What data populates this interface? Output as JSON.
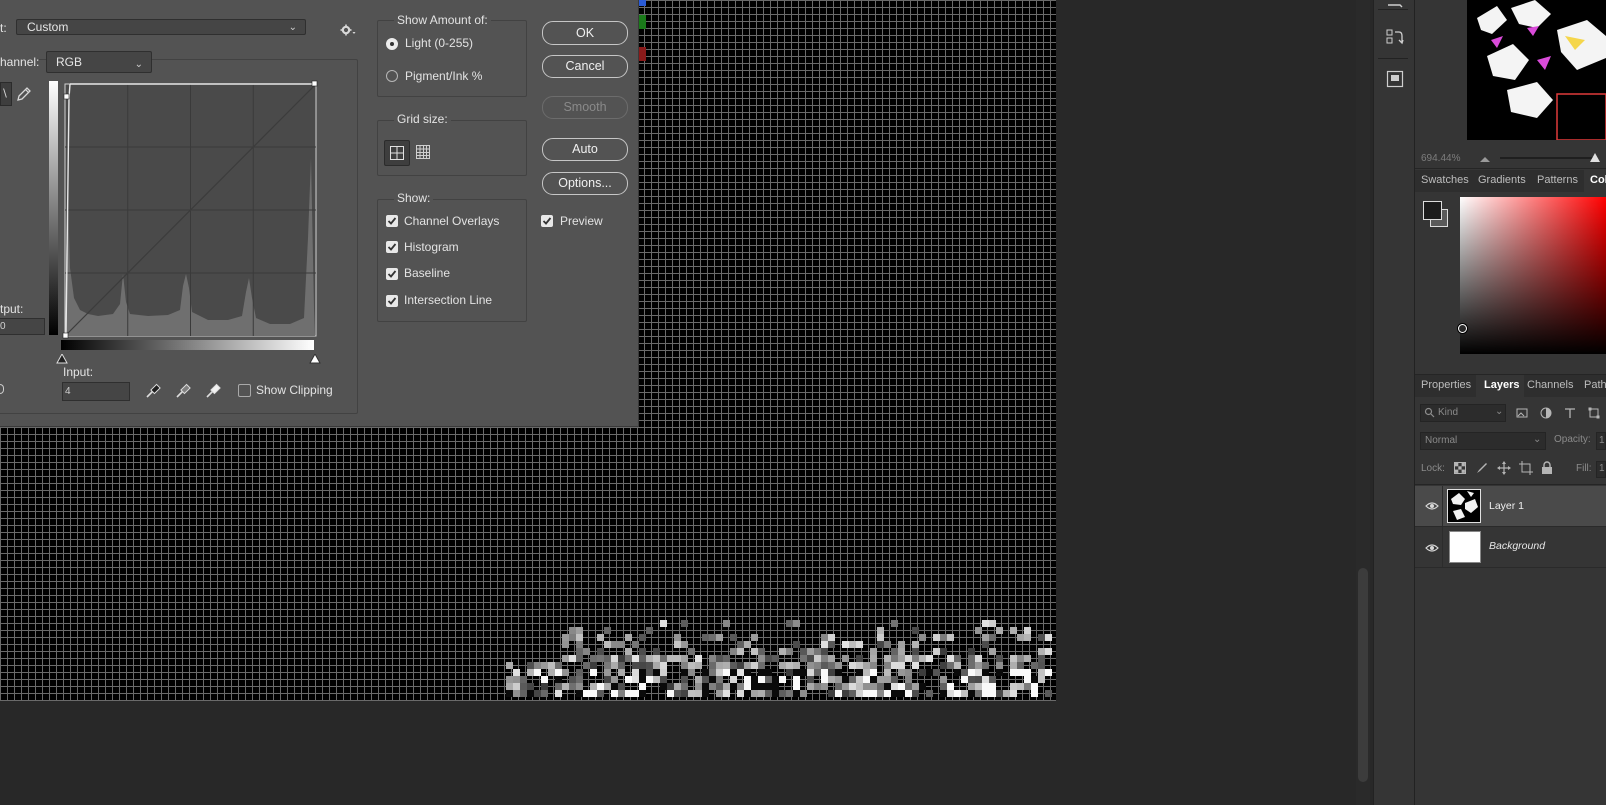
{
  "dialog": {
    "preset_label_partial": "t:",
    "preset_value": "Custom",
    "channel_label_partial": "hannel:",
    "channel_value": "RGB",
    "output_label_partial": "tput:",
    "output_value_partial": "0",
    "input_label": "Input:",
    "input_value": "4",
    "show_clipping_label": "Show Clipping",
    "show_amount": {
      "title": "Show Amount of:",
      "options": [
        {
          "label": "Light  (0-255)",
          "selected": true
        },
        {
          "label": "Pigment/Ink %",
          "selected": false
        }
      ]
    },
    "grid_size": {
      "title": "Grid size:"
    },
    "show": {
      "title": "Show:",
      "options": [
        {
          "label": "Channel Overlays",
          "checked": true
        },
        {
          "label": "Histogram",
          "checked": true
        },
        {
          "label": "Baseline",
          "checked": true
        },
        {
          "label": "Intersection Line",
          "checked": true
        }
      ]
    },
    "buttons": {
      "ok": "OK",
      "cancel": "Cancel",
      "smooth": "Smooth",
      "auto": "Auto",
      "options": "Options..."
    },
    "preview_label": "Preview",
    "preview_checked": true
  },
  "navigator": {
    "zoom": "694.44%"
  },
  "color_panel": {
    "tabs": [
      "Swatches",
      "Gradients",
      "Patterns",
      "Col"
    ],
    "active_tab": "Col",
    "hue_color": "#ff0000"
  },
  "layers_panel": {
    "tabs": [
      "Properties",
      "Layers",
      "Channels",
      "Path"
    ],
    "active_tab": "Layers",
    "filter_placeholder": "Kind",
    "blend_mode": "Normal",
    "opacity_label": "Opacity:",
    "opacity_value_partial": "1",
    "lock_label": "Lock:",
    "fill_label": "Fill:",
    "fill_value_partial": "1",
    "layers": [
      {
        "name": "Layer 1",
        "visible": true,
        "selected": true,
        "italic": false
      },
      {
        "name": "Background",
        "visible": true,
        "selected": false,
        "italic": true
      }
    ]
  },
  "icons": [
    "gear-icon",
    "curve-point-icon",
    "pencil-icon",
    "eyedropper-black-icon",
    "eyedropper-gray-icon",
    "eyedropper-white-icon",
    "grid-simple-icon",
    "grid-detailed-icon",
    "eye-icon",
    "search-icon",
    "lock-transparent-icon",
    "lock-brush-icon",
    "lock-move-icon",
    "lock-artboard-icon",
    "lock-all-icon"
  ]
}
